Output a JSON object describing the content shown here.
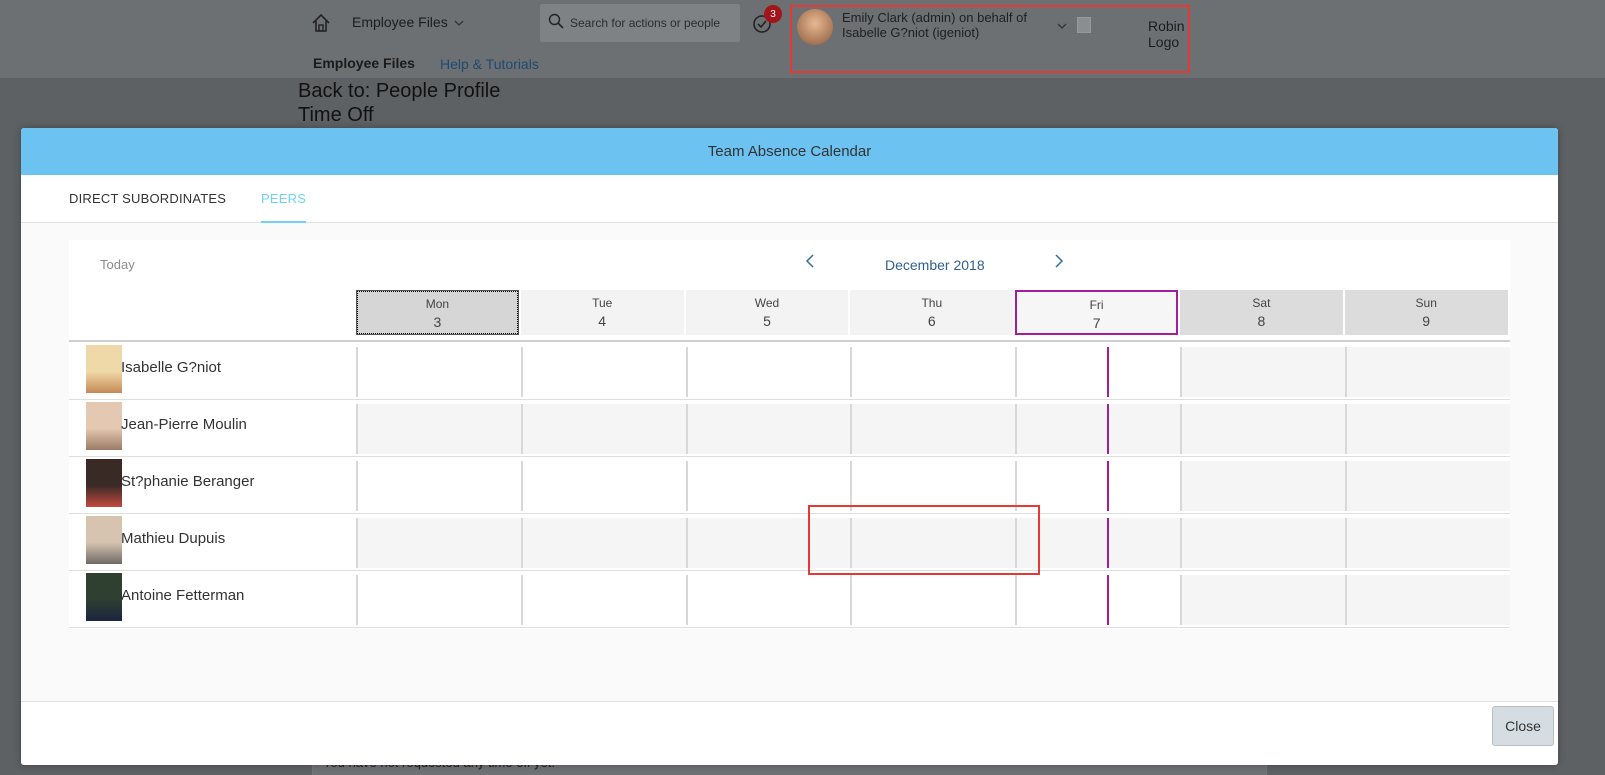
{
  "shell": {
    "app_menu": "Employee Files",
    "search_placeholder": "Search for actions or people",
    "notification_count": "3",
    "user_line1": "Emily Clark (admin) on behalf of",
    "user_line2": "Isabelle G?niot (igeniot)",
    "logo_text": "Robin Logo",
    "nav_files": "Employee Files",
    "nav_help": "Help & Tutorials"
  },
  "page": {
    "back_link": "Back to: People Profile",
    "title": "Time Off",
    "no_time_off": "You have not requested any time off yet."
  },
  "dialog": {
    "title": "Team Absence Calendar",
    "tabs": [
      {
        "label": "DIRECT SUBORDINATES",
        "active": false
      },
      {
        "label": "PEERS",
        "active": true
      }
    ],
    "today_label": "Today",
    "month_label": "December 2018",
    "days": [
      {
        "name": "Mon",
        "num": "3",
        "type": "selected"
      },
      {
        "name": "Tue",
        "num": "4",
        "type": "weekday"
      },
      {
        "name": "Wed",
        "num": "5",
        "type": "weekday"
      },
      {
        "name": "Thu",
        "num": "6",
        "type": "weekday"
      },
      {
        "name": "Fri",
        "num": "7",
        "type": "today"
      },
      {
        "name": "Sat",
        "num": "8",
        "type": "weekend"
      },
      {
        "name": "Sun",
        "num": "9",
        "type": "weekend"
      }
    ],
    "people": [
      {
        "name": "Isabelle G?niot"
      },
      {
        "name": "Jean-Pierre Moulin"
      },
      {
        "name": "St?phanie Beranger"
      },
      {
        "name": "Mathieu Dupuis"
      },
      {
        "name": "Antoine Fetterman"
      }
    ],
    "close_label": "Close"
  },
  "colors": {
    "header_blue": "#6cc3f2",
    "today_purple": "#a51d9a",
    "highlight_red": "#e53935"
  }
}
